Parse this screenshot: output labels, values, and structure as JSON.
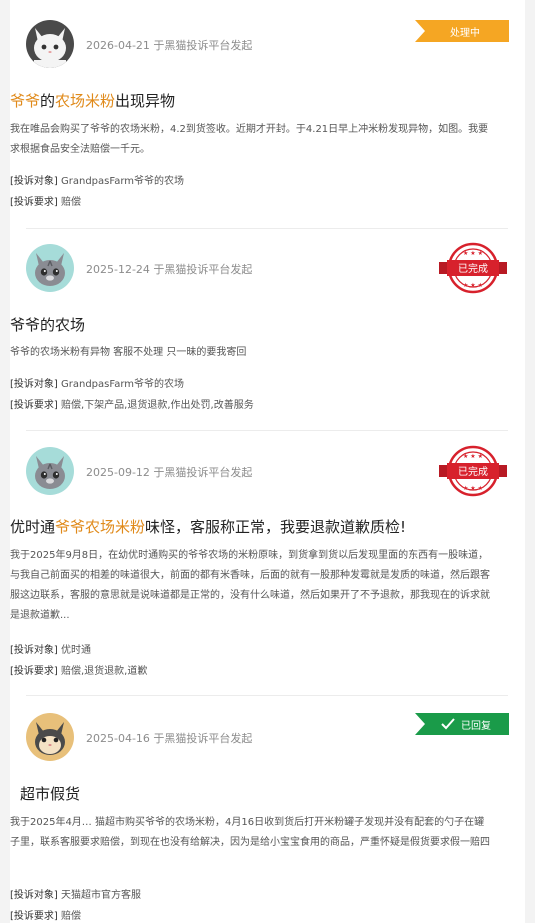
{
  "complaints": [
    {
      "meta": "2026-04-21 于黑猫投诉平台发起",
      "status": "处理中",
      "title_parts": [
        "爷爷",
        "的",
        "农场米粉",
        "出现异物"
      ],
      "description": "我在唯品会购买了爷爷的农场米粉，4.2到货签收。近期才开封。于4.21日早上冲米粉发现异物，如图。我要求根据食品安全法赔偿一千元。",
      "target_label": "[投诉对象]",
      "target": "GrandpasFarm爷爷的农场",
      "demand_label": "[投诉要求]",
      "demand": "赔偿"
    },
    {
      "meta": "2025-12-24 于黑猫投诉平台发起",
      "status": "已完成",
      "title": "爷爷的农场",
      "description": "爷爷的农场米粉有异物 客服不处理 只一昧的要我寄回",
      "target_label": "[投诉对象]",
      "target": "GrandpasFarm爷爷的农场",
      "demand_label": "[投诉要求]",
      "demand": "赔偿,下架产品,退货退款,作出处罚,改善服务"
    },
    {
      "meta": "2025-09-12 于黑猫投诉平台发起",
      "status": "已完成",
      "title_parts": [
        "优时通",
        "爷爷农场米粉",
        "味怪，客服称正常，我要退款道歉质检!"
      ],
      "description": "我于2025年9月8日，在幼优时通购买的爷爷农场的米粉原味，到货拿到货以后发现里面的东西有一股味道，与我自己前面买的相差的味道很大，前面的都有米香味，后面的就有一股那种发霉就是发质的味道，然后跟客服这边联系，客服的意思就是说味道都是正常的，没有什么味道，然后如果开了不予退款，那我现在的诉求就是退款道歉...",
      "target_label": "[投诉对象]",
      "target": "优时通",
      "demand_label": "[投诉要求]",
      "demand": "赔偿,退货退款,道歉"
    },
    {
      "meta": "2025-04-16 于黑猫投诉平台发起",
      "status": "已回复",
      "title": "超市假货",
      "description": "我于2025年4月… 猫超市购买爷爷的农场米粉，4月16日收到货后打开米粉罐子发现并没有配套的勺子在罐子里，联系客服要求赔偿，到现在也没有给解决，因为是给小宝宝食用的商品，严重怀疑是假货要求假一赔四",
      "target_label": "[投诉对象]",
      "target": "天猫超市官方客服",
      "demand_label": "[投诉要求]",
      "demand": "赔偿"
    }
  ],
  "colors": {
    "processing": "#f5a623",
    "done": "#d7212c",
    "replied": "#1a9b49",
    "highlight": "#e08a1a"
  },
  "icons": {
    "avatar": "cat-avatar-icon",
    "stamp": "completed-stamp-icon",
    "check": "check-icon"
  }
}
